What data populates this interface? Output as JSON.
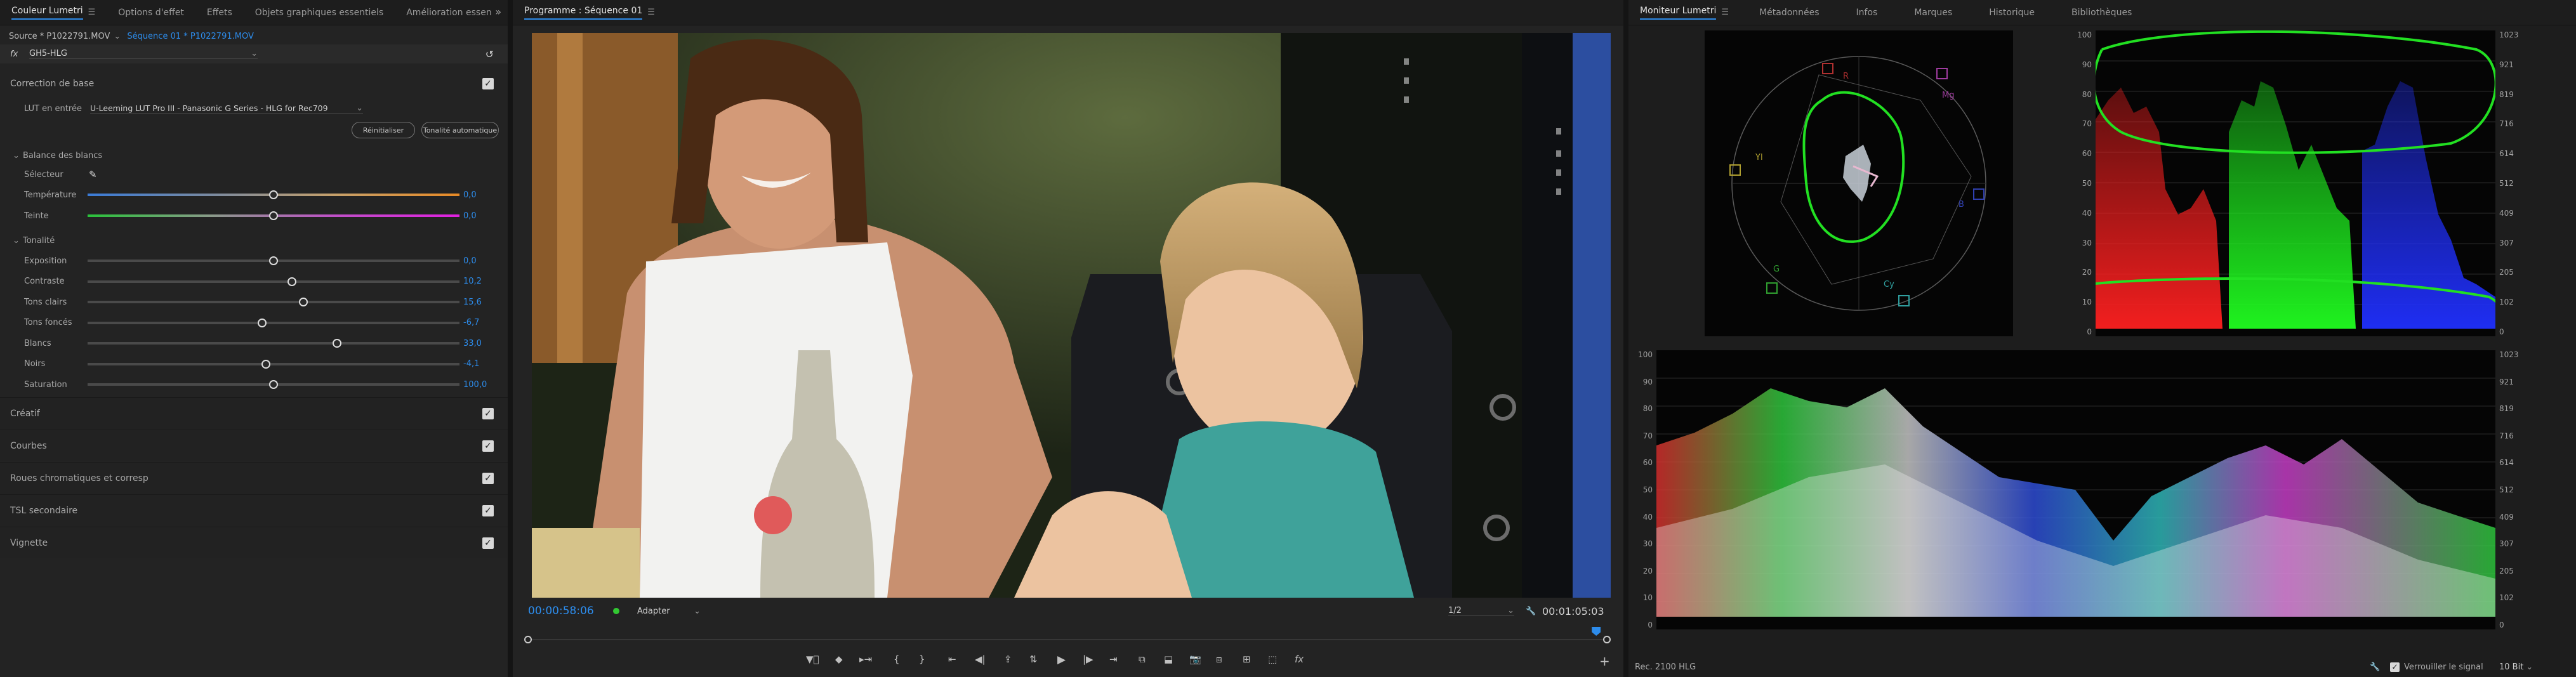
{
  "lumetri": {
    "tabs": [
      {
        "label": "Couleur Lumetri",
        "active": true
      },
      {
        "label": "Options d'effet",
        "active": false
      },
      {
        "label": "Effets",
        "active": false
      },
      {
        "label": "Objets graphiques essentiels",
        "active": false
      },
      {
        "label": "Amélioration essen",
        "active": false
      }
    ],
    "source_label": "Source * P1022791.MOV",
    "sequence_link": "Séquence 01 * P1022791.MOV",
    "fx_label": "fx",
    "effect_name": "GH5-HLG",
    "basic_correction": {
      "title": "Correction de base",
      "lut_label": "LUT en entrée",
      "lut_value": "U-Leeming LUT Pro III - Panasonic G Series - HLG for Rec709",
      "reset_button": "Réinitialiser",
      "auto_button": "Tonalité automatique",
      "white_balance_title": "Balance des blancs",
      "selector_label": "Sélecteur",
      "tone_title": "Tonalité"
    },
    "wb_sliders": [
      {
        "label": "Température",
        "value": "0,0",
        "position": 0.5,
        "gradient": "linear-gradient(90deg,#3a7bd8,#7a8aa0,#c6a06a,#e88a25)"
      },
      {
        "label": "Teinte",
        "value": "0,0",
        "position": 0.5,
        "gradient": "linear-gradient(90deg,#29c23a,#8a9a8a,#c050c8,#e020e0)"
      }
    ],
    "tone_sliders": [
      {
        "label": "Exposition",
        "value": "0,0",
        "position": 0.5
      },
      {
        "label": "Contraste",
        "value": "10,2",
        "position": 0.55
      },
      {
        "label": "Tons clairs",
        "value": "15,6",
        "position": 0.58
      },
      {
        "label": "Tons foncés",
        "value": "-6,7",
        "position": 0.47
      },
      {
        "label": "Blancs",
        "value": "33,0",
        "position": 0.67
      },
      {
        "label": "Noirs",
        "value": "-4,1",
        "position": 0.48
      },
      {
        "label": "Saturation",
        "value": "100,0",
        "position": 0.5
      }
    ],
    "sections": [
      "Créatif",
      "Courbes",
      "Roues chromatiques et corresp",
      "TSL secondaire",
      "Vignette"
    ]
  },
  "program": {
    "tab_label": "Programme : Séquence 01",
    "timecode": "00:00:58:06",
    "fit_label": "Adapter",
    "resolution_label": "1/2",
    "duration": "00:01:05:03",
    "playhead_position": 0.0,
    "in_marker_position": 0.99
  },
  "scopes": {
    "tabs": [
      {
        "label": "Moniteur Lumetri",
        "active": true
      },
      {
        "label": "Métadonnées",
        "active": false
      },
      {
        "label": "Infos",
        "active": false
      },
      {
        "label": "Marques",
        "active": false
      },
      {
        "label": "Historique",
        "active": false
      },
      {
        "label": "Bibliothèques",
        "active": false
      }
    ],
    "vectorscope_labels": [
      "R",
      "Mg",
      "B",
      "Cy",
      "G",
      "Yl"
    ],
    "parade_left_ticks": [
      "100",
      "90",
      "80",
      "70",
      "60",
      "50",
      "40",
      "30",
      "20",
      "10",
      "0"
    ],
    "parade_right_ticks": [
      "1023",
      "921",
      "819",
      "716",
      "614",
      "512",
      "409",
      "307",
      "205",
      "102",
      "0"
    ],
    "waveform_left_ticks": [
      "100",
      "90",
      "80",
      "70",
      "60",
      "50",
      "40",
      "30",
      "20",
      "10",
      "0"
    ],
    "waveform_right_ticks": [
      "1023",
      "921",
      "819",
      "716",
      "614",
      "512",
      "409",
      "307",
      "205",
      "102",
      "0"
    ],
    "color_space_label": "Rec. 2100 HLG",
    "signal_lock_label": "Verrouiller le signal",
    "bit_depth": "10 Bit"
  },
  "colors": {
    "accent_blue": "#2d8ceb",
    "annotation_green": "#22e022",
    "panel_bg": "#232323"
  }
}
